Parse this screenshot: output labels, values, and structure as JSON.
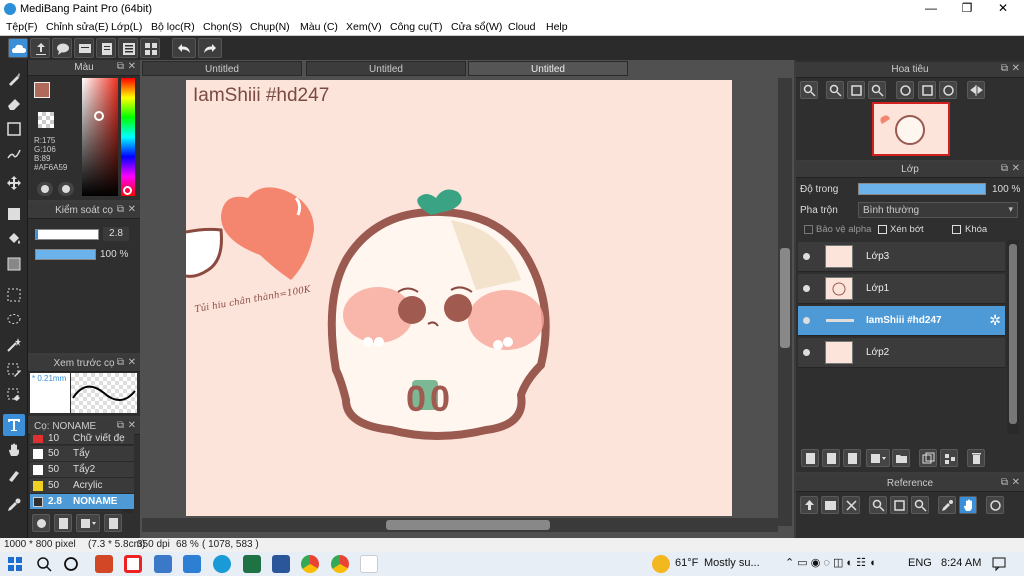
{
  "window": {
    "title": "MediBang Paint Pro (64bit)"
  },
  "menu": [
    "Tệp(F)",
    "Chỉnh sửa(E)",
    "Lớp(L)",
    "Bộ lọc(R)",
    "Chọn(S)",
    "Chụp(N)",
    "Màu (C)",
    "Xem(V)",
    "Công cụ(T)",
    "Cửa sổ(W)",
    "Cloud",
    "Help"
  ],
  "tabs": [
    "Untitled",
    "Untitled",
    "Untitled"
  ],
  "color_panel": {
    "title": "Màu",
    "r": "R:175",
    "g": "G:106",
    "b": "B:89",
    "hex": "#AF6A59",
    "fg": "#af6a59"
  },
  "brush_control": {
    "title": "Kiểm soát cọ",
    "size": "2.8",
    "opacity": "100 %",
    "opacity_value": 1.0
  },
  "brush_preview": {
    "title": "Xem trước cọ",
    "size": "* 0.21mm"
  },
  "brush_list": {
    "title": "Cọ: NONAME",
    "items": [
      {
        "size": "10",
        "name": "Chữ viết đẹ",
        "color": "#e03030"
      },
      {
        "size": "50",
        "name": "Tẩy",
        "color": "#ffffff"
      },
      {
        "size": "50",
        "name": "Tẩy2",
        "color": "#ffffff"
      },
      {
        "size": "50",
        "name": "Acrylic",
        "color": "#f0d020"
      },
      {
        "size": "2.8",
        "name": "NONAME",
        "color": "#2f2f2f"
      }
    ]
  },
  "canvas": {
    "text": "IamShiii #hd247",
    "sketch_note": "Tủi hiu chân thành=100K",
    "face_text": "00"
  },
  "navigator": {
    "title": "Hoa tiêu"
  },
  "layer_panel": {
    "title": "Lớp",
    "opacity_label": "Độ trong",
    "opacity": "100 %",
    "opacity_value": 1.0,
    "blend_label": "Pha trộn",
    "blend_value": "Bình thường",
    "alpha_lock": "Bảo vệ alpha",
    "clip": "Xén bớt",
    "lock": "Khóa",
    "layers": [
      "Lớp3",
      "Lớp1",
      "IamShiii #hd247",
      "Lớp2"
    ]
  },
  "reference": {
    "title": "Reference"
  },
  "status": {
    "size": "1000 * 800 pixel",
    "cm": "(7.3 * 5.8cm)",
    "dpi": "350 dpi",
    "zoom": "68 %",
    "coords": "( 1078, 583 )"
  },
  "taskbar": {
    "temp": "61°F",
    "weather": "Mostly su...",
    "lang": "ENG",
    "time": "8:24 AM"
  }
}
